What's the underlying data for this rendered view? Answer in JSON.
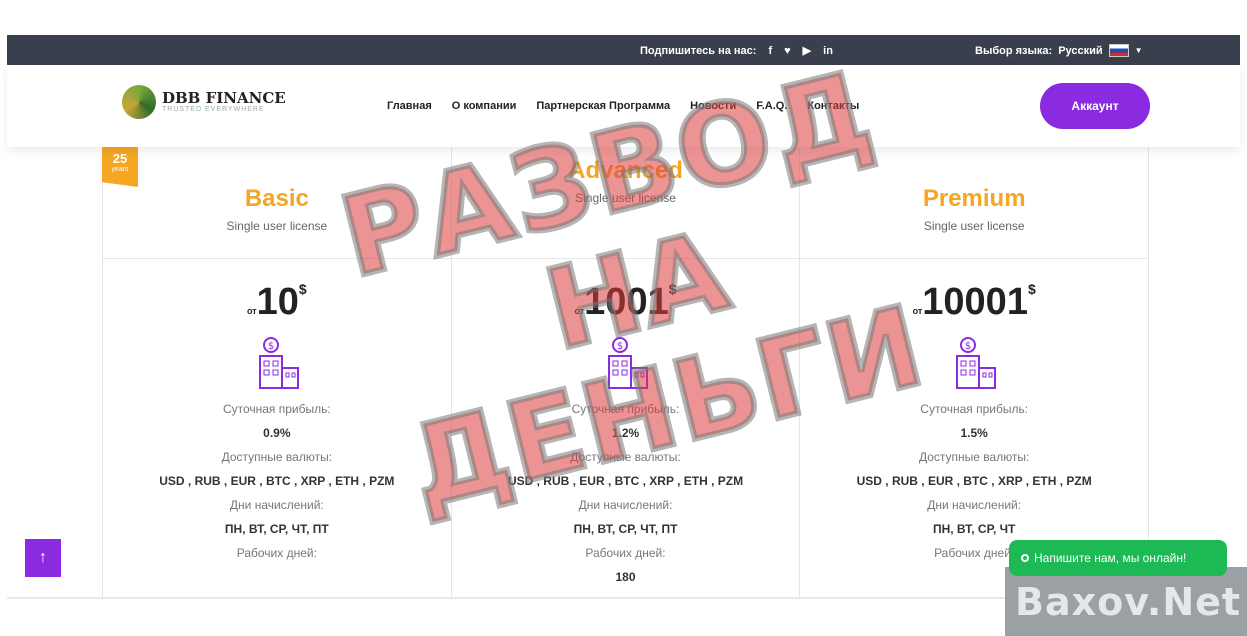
{
  "topbar": {
    "subscribe_label": "Подпишитесь на нас:",
    "socials": [
      "f",
      "♥",
      "▶",
      "in"
    ],
    "lang_label": "Выбор языка:",
    "lang_value": "Русский"
  },
  "logo": {
    "name": "DBB FINANCE",
    "tagline": "TRUSTED EVERYWHERE"
  },
  "nav": [
    "Главная",
    "О компании",
    "Партнерская Программа",
    "Новости",
    "F.A.Q.",
    "Контакты"
  ],
  "account_label": "Аккаунт",
  "ribbon": {
    "number": "25",
    "unit": "years"
  },
  "plans": [
    {
      "title": "Basic",
      "sub": "Single user license",
      "price_prefix": "от",
      "price": "10",
      "currency": "$",
      "profit_label": "Суточная прибыль:",
      "profit": "0.9%",
      "currencies_label": "Доступные валюты:",
      "currencies": "USD , RUB , EUR , BTC , XRP , ETH , PZM",
      "days_label": "Дни начислений:",
      "days": "ПН, ВТ, СР, ЧТ, ПТ",
      "work_label": "Рабочих дней:"
    },
    {
      "title": "Advanced",
      "sub": "Single user license",
      "price_prefix": "от",
      "price": "1001",
      "currency": "$",
      "profit_label": "Суточная прибыль:",
      "profit": "1.2%",
      "currencies_label": "Доступные валюты:",
      "currencies": "USD , RUB , EUR , BTC , XRP , ETH , PZM",
      "days_label": "Дни начислений:",
      "days": "ПН, ВТ, СР, ЧТ, ПТ",
      "work_label": "Рабочих дней:",
      "work": "180"
    },
    {
      "title": "Premium",
      "sub": "Single user license",
      "price_prefix": "от",
      "price": "10001",
      "currency": "$",
      "profit_label": "Суточная прибыль:",
      "profit": "1.5%",
      "currencies_label": "Доступные валюты:",
      "currencies": "USD , RUB , EUR , BTC , XRP , ETH , PZM",
      "days_label": "Дни начислений:",
      "days": "ПН, ВТ, СР, ЧТ",
      "work_label": "Рабочих дней:"
    }
  ],
  "stamp": {
    "line1": "РАЗВОД",
    "line2": "НА ДЕНЬГИ"
  },
  "up_icon": "↑",
  "chat_label": "Напишите нам, мы онлайн!",
  "watermark": "Baxov.Net",
  "colors": {
    "accent": "#8a2be2",
    "gold": "#f5a623",
    "topbar": "#3a3f4d",
    "chat": "#1db954"
  }
}
